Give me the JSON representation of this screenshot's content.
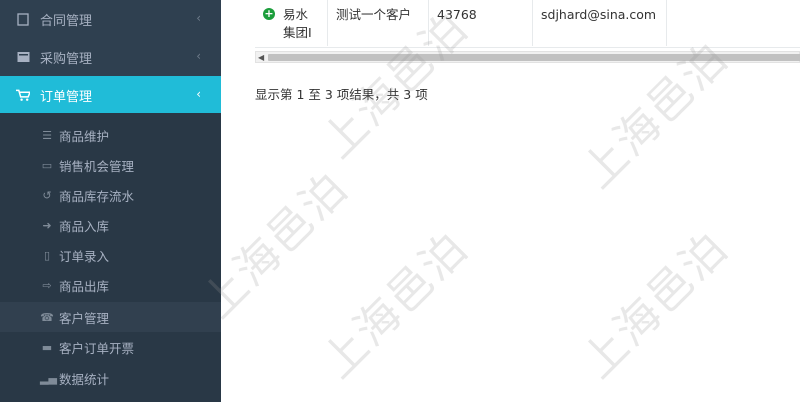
{
  "sidebar": {
    "menu": [
      {
        "label": "合同管理",
        "icon": "document-icon"
      },
      {
        "label": "采购管理",
        "icon": "folder-icon"
      },
      {
        "label": "订单管理",
        "icon": "cart-icon",
        "active": true
      }
    ],
    "submenu": [
      {
        "label": "商品维护",
        "icon": "database-icon"
      },
      {
        "label": "销售机会管理",
        "icon": "keyboard-icon"
      },
      {
        "label": "商品库存流水",
        "icon": "history-icon"
      },
      {
        "label": "商品入库",
        "icon": "sign-in-icon"
      },
      {
        "label": "订单录入",
        "icon": "bookmark-icon"
      },
      {
        "label": "商品出库",
        "icon": "sign-out-icon"
      },
      {
        "label": "客户管理",
        "icon": "phone-icon",
        "current": true
      },
      {
        "label": "客户订单开票",
        "icon": "credit-card-icon"
      },
      {
        "label": "数据统计",
        "icon": "bar-chart-icon"
      }
    ]
  },
  "table": {
    "row": {
      "customer": "易水集团I",
      "description": "测试一个客户",
      "number": "43768",
      "email": "sdjhard@sina.com",
      "extra": ""
    }
  },
  "pager": {
    "info": "显示第 1 至 3 项结果，共 3 项"
  },
  "watermark": "上海邑泊",
  "colors": {
    "sidebar_bg": "#2f4050",
    "submenu_bg": "#293846",
    "active_bg": "#20bcd8",
    "expand_icon": "#1c9e3c"
  }
}
